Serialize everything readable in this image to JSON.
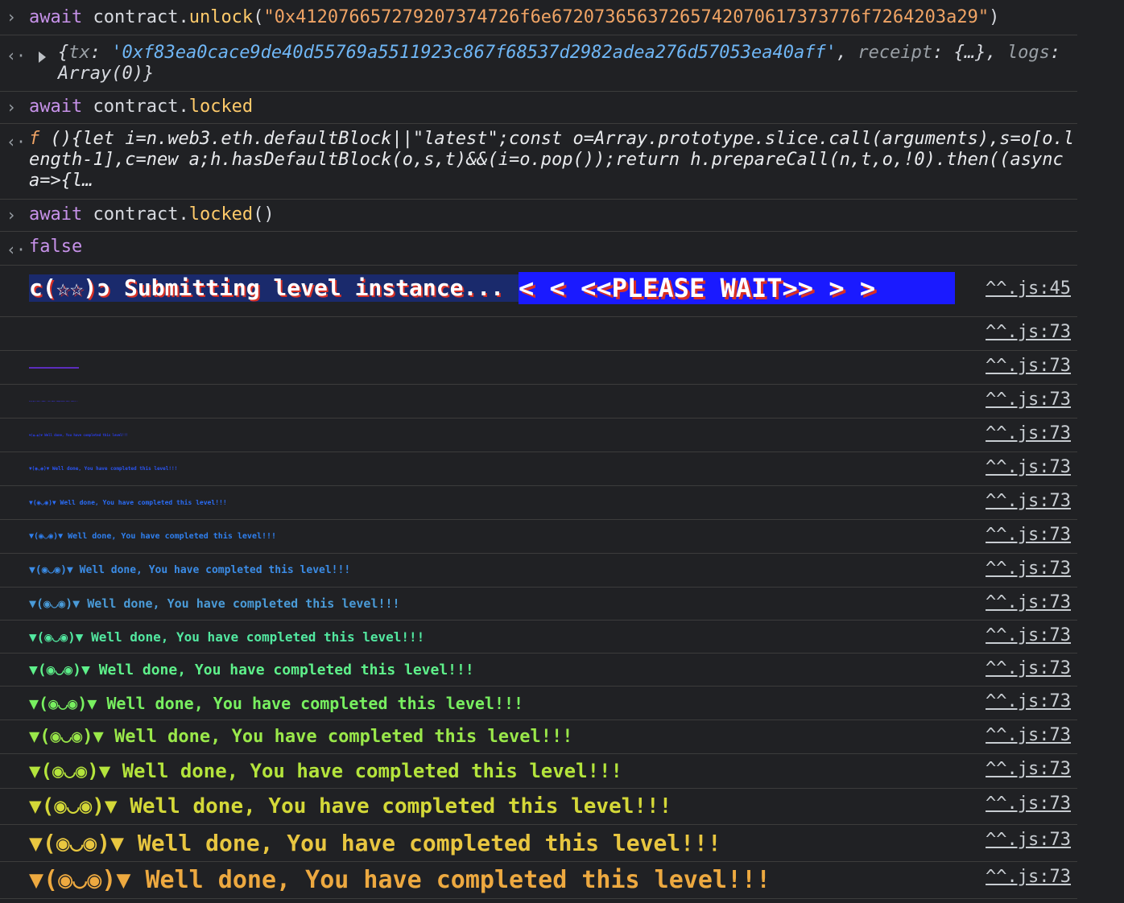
{
  "entries": {
    "unlock_cmd": {
      "await": "await",
      "obj": "contract",
      "dot": ".",
      "method": "unlock",
      "open": "(",
      "arg": "\"0x412076657279207374726f6e67207365637265742070617373776f7264203a29\"",
      "close": ")"
    },
    "unlock_result": {
      "open": "{",
      "k1": "tx",
      "colon1": ": ",
      "v1": "'0xf83ea0cace9de40d55769a5511923c867f68537d2982adea276d57053ea40aff'",
      "comma1": ", ",
      "k2": "receipt",
      "colon2": ": ",
      "v2": "{…}",
      "comma2": ", ",
      "k3": "logs",
      "colon3": ": ",
      "v3": "Array(0)",
      "close": "}"
    },
    "locked_cmd": {
      "await": "await",
      "obj": "contract",
      "dot": ".",
      "prop": "locked"
    },
    "locked_result": {
      "f": "f",
      "body": " (){let i=n.web3.eth.defaultBlock||\"latest\";const o=Array.prototype.slice.call(arguments),s=o[o.length-1],c=new a;h.hasDefaultBlock(o,s,t)&&(i=o.pop());return h.prepareCall(n,t,o,!0).then((async a=>{l…"
    },
    "locked_call_cmd": {
      "await": "await",
      "obj": "contract",
      "dot": ".",
      "prop": "locked",
      "parens": "()"
    },
    "locked_call_result": "false"
  },
  "banner": {
    "left": "c(☆☆)ɔ Submitting level instance...",
    "right": "<  < <<PLEASE WAIT>> >  >",
    "source": "^^.js:45"
  },
  "logs": [
    {
      "text": "",
      "source": "^^.js:73",
      "color": "#202124"
    },
    {
      "text": "▼(◉◡◉)▼ Well done, You have completed this level!!!",
      "source": "^^.js:73",
      "color": "#5b2dbb"
    },
    {
      "text": "▼(◉◡◉)▼ Well done, You have completed this level!!!",
      "source": "^^.js:73",
      "color": "#3a32d8"
    },
    {
      "text": "▼(◉◡◉)▼ Well done, You have completed this level!!!",
      "source": "^^.js:73",
      "color": "#2a3ef0"
    },
    {
      "text": "▼(◉◡◉)▼ Well done, You have completed this level!!!",
      "source": "^^.js:73",
      "color": "#2a55f5"
    },
    {
      "text": "▼(◉◡◉)▼ Well done, You have completed this level!!!",
      "source": "^^.js:73",
      "color": "#2a6cf5"
    },
    {
      "text": "▼(◉◡◉)▼ Well done, You have completed this level!!!",
      "source": "^^.js:73",
      "color": "#2f80f0"
    },
    {
      "text": "▼(◉◡◉)▼ Well done, You have completed this level!!!",
      "source": "^^.js:73",
      "color": "#3b8ce6"
    },
    {
      "text": "▼(◉◡◉)▼ Well done, You have completed this level!!!",
      "source": "^^.js:73",
      "color": "#4a9bd8"
    },
    {
      "text": "▼(◉◡◉)▼ Well done, You have completed this level!!!",
      "source": "^^.js:73",
      "color": "#52e8a0"
    },
    {
      "text": "▼(◉◡◉)▼ Well done, You have completed this level!!!",
      "source": "^^.js:73",
      "color": "#5ef08a"
    },
    {
      "text": "▼(◉◡◉)▼ Well done, You have completed this level!!!",
      "source": "^^.js:73",
      "color": "#78f060"
    },
    {
      "text": "▼(◉◡◉)▼ Well done, You have completed this level!!!",
      "source": "^^.js:73",
      "color": "#9ae84a"
    },
    {
      "text": "▼(◉◡◉)▼ Well done, You have completed this level!!!",
      "source": "^^.js:73",
      "color": "#b4e43c"
    },
    {
      "text": "▼(◉◡◉)▼ Well done, You have completed this level!!!",
      "source": "^^.js:73",
      "color": "#d4d838"
    },
    {
      "text": "▼(◉◡◉)▼ Well done, You have completed this level!!!",
      "source": "^^.js:73",
      "color": "#e8c640"
    },
    {
      "text": "▼(◉◡◉)▼ Well done, You have completed this level!!!",
      "source": "^^.js:73",
      "color": "#eda940"
    }
  ]
}
